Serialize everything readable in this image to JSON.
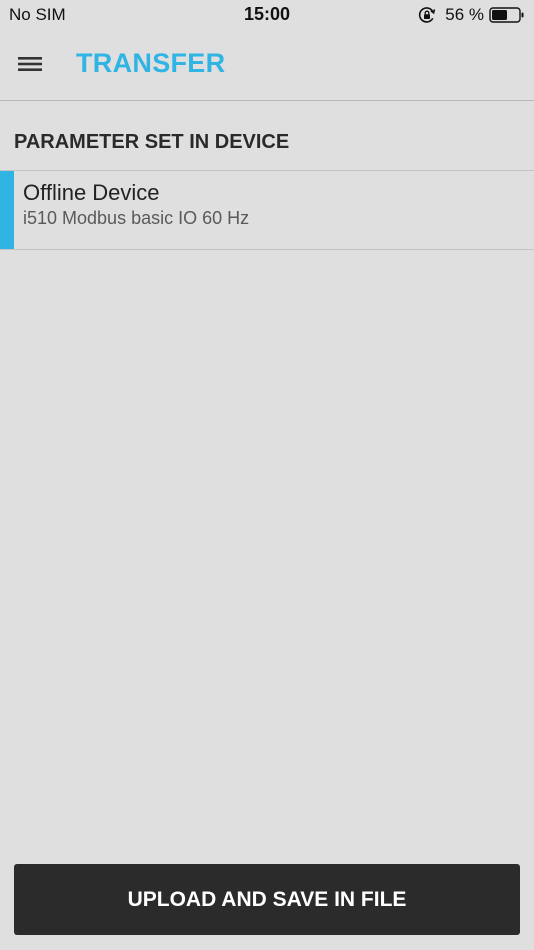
{
  "status_bar": {
    "carrier": "No SIM",
    "time": "15:00",
    "battery_percent": "56 %",
    "icons": {
      "orientation_lock": "orientation-lock-icon",
      "battery": "battery-icon"
    }
  },
  "header": {
    "title": "TRANSFER",
    "menu_icon": "hamburger-menu-icon"
  },
  "section": {
    "title": "PARAMETER SET IN DEVICE"
  },
  "device": {
    "name": "Offline Device",
    "description": "i510 Modbus basic IO 60 Hz"
  },
  "actions": {
    "upload_label": "UPLOAD AND SAVE IN FILE"
  },
  "colors": {
    "accent": "#2fb4e3",
    "background": "#dfdfdf",
    "button": "#2b2b2b"
  }
}
